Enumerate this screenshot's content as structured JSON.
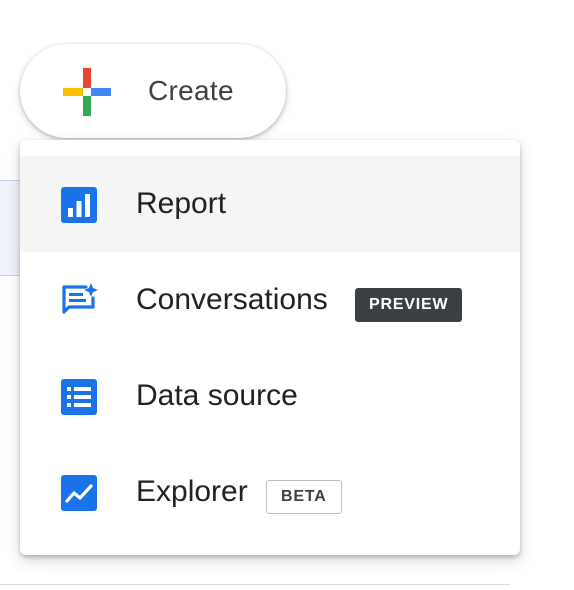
{
  "create_button": {
    "label": "Create",
    "icon": "google-plus-icon"
  },
  "menu": {
    "items": [
      {
        "label": "Report",
        "icon": "bar-chart-icon",
        "highlighted": true
      },
      {
        "label": "Conversations",
        "icon": "chat-sparkle-icon",
        "badge": "PREVIEW"
      },
      {
        "label": "Data source",
        "icon": "list-icon"
      },
      {
        "label": "Explorer",
        "icon": "trend-line-icon",
        "badge": "BETA"
      }
    ]
  },
  "colors": {
    "icon_blue": "#1a73e8",
    "plus_red": "#ea4335",
    "plus_blue": "#4285f4",
    "plus_green": "#34a853",
    "plus_yellow": "#fbbc04",
    "highlight_bg": "#f5f5f5",
    "preview_badge_bg": "#3c4043"
  }
}
